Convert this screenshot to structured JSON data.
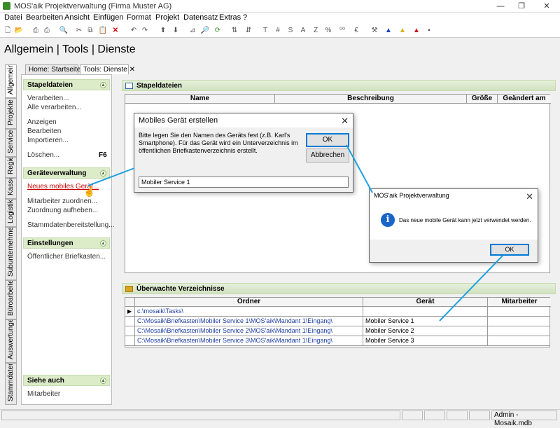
{
  "window": {
    "title": "MOS'aik Projektverwaltung (Firma Muster AG)"
  },
  "menu": [
    "Datei",
    "Bearbeiten",
    "Ansicht",
    "Einfügen",
    "Format",
    "Projekt",
    "Datensatz",
    "Extras",
    "?"
  ],
  "page_title": "Allgemein | Tools | Dienste",
  "vertical_tabs": [
    "Allgemein",
    "Projekte",
    "Service",
    "Regie",
    "Kasse",
    "Logistik",
    "Subunternehmer",
    "Büroarbeiten",
    "Auswertungen",
    "Stammdaten"
  ],
  "doc_tabs": [
    "Home: Startseite",
    "Tools: Dienste"
  ],
  "sidebar": {
    "sections": [
      {
        "title": "Stapeldateien",
        "items": [
          "Verarbeiten...",
          "Alle verarbeiten...",
          "Anzeigen",
          "Bearbeiten",
          "Importieren...",
          "Löschen..."
        ],
        "shortcut": "F6"
      },
      {
        "title": "Geräteverwaltung",
        "items": [
          "Neues mobiles Gerät...",
          "Mitarbeiter zuordnen...",
          "Zuordnung aufheben...",
          "Stammdatenbereitstellung..."
        ]
      },
      {
        "title": "Einstellungen",
        "items": [
          "Öffentlicher Briefkasten..."
        ]
      },
      {
        "title": "Siehe auch",
        "items": [
          "Mitarbeiter"
        ]
      }
    ]
  },
  "stapel_panel": {
    "title": "Stapeldateien",
    "columns": [
      "Name",
      "Beschreibung",
      "Größe",
      "Geändert am"
    ]
  },
  "folders_panel": {
    "title": "Überwachte Verzeichnisse",
    "columns": [
      "Ordner",
      "Gerät",
      "Mitarbeiter"
    ],
    "rows": [
      {
        "ordner": "c:\\mosaik\\Tasks\\",
        "geraet": "",
        "mitarbeiter": ""
      },
      {
        "ordner": "C:\\Mosaik\\Briefkasten\\Mobiler Service 1\\MOS'aik\\Mandant 1\\Eingang\\",
        "geraet": "Mobiler Service 1",
        "mitarbeiter": ""
      },
      {
        "ordner": "C:\\Mosaik\\Briefkasten\\Mobiler Service 2\\MOS'aik\\Mandant 1\\Eingang\\",
        "geraet": "Mobiler Service 2",
        "mitarbeiter": ""
      },
      {
        "ordner": "C:\\Mosaik\\Briefkasten\\Mobiler Service 3\\MOS'aik\\Mandant 1\\Eingang\\",
        "geraet": "Mobiler Service 3",
        "mitarbeiter": ""
      }
    ]
  },
  "dialog_create": {
    "title": "Mobiles Gerät erstellen",
    "message": "Bitte legen Sie den Namen des Geräts fest (z.B. Karl's Smartphone). Für das Gerät wird ein Unterverzeichnis im öffentlichen Briefkastenverzeichnis erstellt.",
    "ok": "OK",
    "cancel": "Abbrechen",
    "input_value": "Mobiler Service 1"
  },
  "dialog_info": {
    "title": "MOS'aik Projektverwaltung",
    "message": "Das neue mobile Gerät kann jetzt verwendet werden.",
    "ok": "OK"
  },
  "statusbar": {
    "user": "Admin - Mosaik.mdb"
  },
  "colors": {
    "accent_green": "#dcebc8",
    "link_red": "#cc0000",
    "arrow_blue": "#1ea0e0"
  }
}
